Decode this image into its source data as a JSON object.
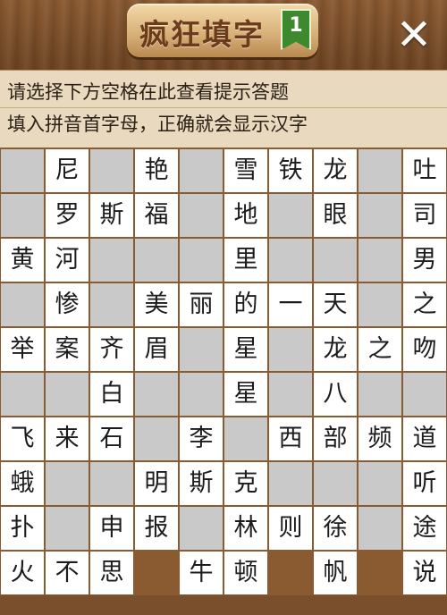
{
  "header": {
    "title": "疯狂填字",
    "level": "1",
    "close_label": "✕"
  },
  "hint": {
    "line1": "请选择下方空格在此查看提示答题",
    "line2": "填入拼音首字母，正确就会显示汉字"
  },
  "grid": {
    "rows": [
      [
        "",
        "尼",
        "",
        "艳",
        "",
        "雪",
        "铁",
        "龙",
        "",
        "吐"
      ],
      [
        "",
        "罗",
        "斯",
        "福",
        "",
        "地",
        "",
        "眼",
        "",
        "司"
      ],
      [
        "黄",
        "河",
        "",
        "",
        "",
        "里",
        "",
        "",
        "",
        "男"
      ],
      [
        "",
        "惨",
        "",
        "美",
        "丽",
        "的",
        "一",
        "天",
        "",
        "之"
      ],
      [
        "举",
        "案",
        "齐",
        "眉",
        "",
        "星",
        "",
        "龙",
        "之",
        "吻"
      ],
      [
        "",
        "",
        "白",
        "",
        "",
        "星",
        "",
        "八",
        "",
        ""
      ],
      [
        "飞",
        "来",
        "石",
        "",
        "李",
        "",
        "西",
        "部",
        "频",
        "道"
      ],
      [
        "蛾",
        "",
        "",
        "明",
        "斯",
        "克",
        "",
        "",
        "",
        "听"
      ],
      [
        "扑",
        "",
        "申",
        "报",
        "",
        "林",
        "则",
        "徐",
        "",
        "途"
      ],
      [
        "火",
        "不",
        "思",
        "",
        "牛",
        "顿",
        "",
        "帆",
        "",
        "说"
      ]
    ],
    "types": [
      [
        "b",
        "f",
        "b",
        "f",
        "b",
        "f",
        "f",
        "f",
        "b",
        "f"
      ],
      [
        "b",
        "f",
        "f",
        "f",
        "b",
        "f",
        "b",
        "f",
        "b",
        "f"
      ],
      [
        "f",
        "f",
        "b",
        "b",
        "b",
        "f",
        "b",
        "b",
        "b",
        "f"
      ],
      [
        "b",
        "f",
        "b",
        "f",
        "f",
        "f",
        "f",
        "f",
        "b",
        "f"
      ],
      [
        "f",
        "f",
        "f",
        "f",
        "b",
        "f",
        "b",
        "f",
        "f",
        "f"
      ],
      [
        "b",
        "b",
        "f",
        "b",
        "b",
        "f",
        "b",
        "f",
        "b",
        "b"
      ],
      [
        "f",
        "f",
        "f",
        "b",
        "f",
        "b",
        "f",
        "f",
        "f",
        "f"
      ],
      [
        "f",
        "b",
        "b",
        "f",
        "f",
        "f",
        "b",
        "b",
        "b",
        "f"
      ],
      [
        "f",
        "b",
        "f",
        "f",
        "b",
        "f",
        "f",
        "f",
        "b",
        "f"
      ],
      [
        "f",
        "f",
        "f",
        "w",
        "f",
        "f",
        "w",
        "f",
        "w",
        "f"
      ]
    ]
  }
}
